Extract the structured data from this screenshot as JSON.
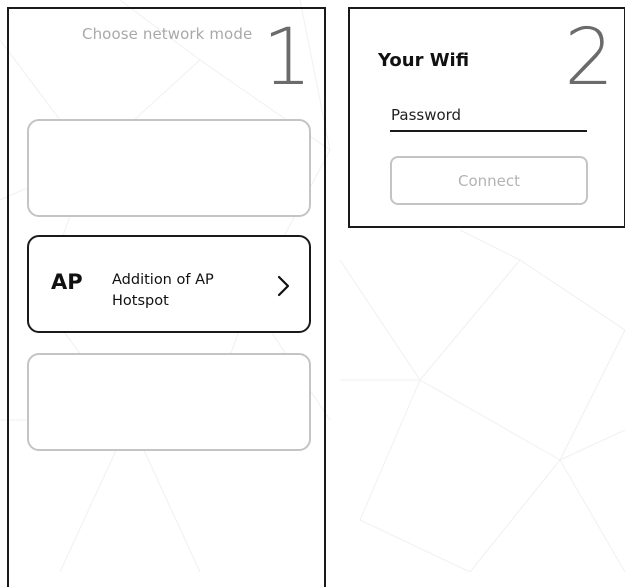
{
  "screen1": {
    "step_number": "1",
    "heading": "Choose network mode",
    "options": [
      {
        "badge": "",
        "label": ""
      },
      {
        "badge": "AP",
        "label": "Addition of AP Hotspot",
        "selected": true,
        "icon": "chevron-right-icon"
      },
      {
        "badge": "",
        "label": ""
      }
    ]
  },
  "screen2": {
    "step_number": "2",
    "title": "Your Wifi",
    "password_label": "Password",
    "connect_label": "Connect"
  },
  "colors": {
    "border_dark": "#1a1a1a",
    "border_light": "#c4c4c4",
    "muted_text": "#a9a9a9",
    "step_number": "#6b6b6b",
    "background_lines": "#f0f0f0"
  }
}
